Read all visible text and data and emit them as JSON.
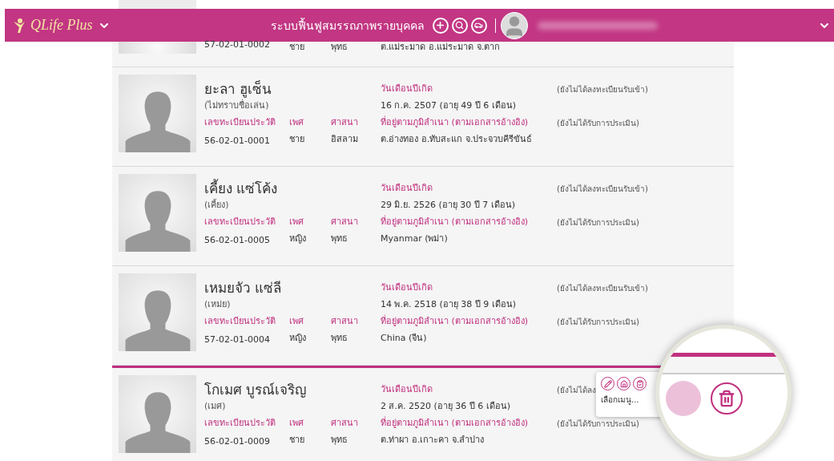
{
  "header": {
    "logo": "QLife Plus",
    "title": "ระบบฟื้นฟูสมรรถภาพรายบุคคล"
  },
  "partial_person": {
    "record_id": "57-02-01-0002",
    "gender": "ชาย",
    "religion": "พุทธ",
    "address": "ต.แม่ระมาด อ.แม่ระมาด จ.ตาก"
  },
  "people": [
    {
      "name": "ยะลา ฮูเซ็น",
      "nickname": "(ไม่ทราบชื่อเล่น)",
      "labels": {
        "record_id": "เลขทะเบียนประวัติ",
        "gender": "เพศ",
        "religion": "ศาสนา",
        "dob": "วันเดือนปีเกิด",
        "address": "ที่อยู่ตามภูมิลำเนา (ตามเอกสารอ้างอิง)"
      },
      "record_id": "56-02-01-0001",
      "gender": "ชาย",
      "religion": "อิสลาม",
      "dob": "16 ก.ค. 2507 (อายุ 49 ปี 6 เดือน)",
      "address": "ต.อ่างทอง อ.ทับสะแก จ.ประจวบคีรีขันธ์",
      "registration_status": "(ยังไม่ได้ลงทะเบียนรับเข้า)",
      "assessment_status": "(ยังไม่ได้รับการประเมิน)",
      "selected": false
    },
    {
      "name": "เคี้ยง แซ่โค้ง",
      "nickname": "(เคี้ยง)",
      "labels": {
        "record_id": "เลขทะเบียนประวัติ",
        "gender": "เพศ",
        "religion": "ศาสนา",
        "dob": "วันเดือนปีเกิด",
        "address": "ที่อยู่ตามภูมิลำเนา (ตามเอกสารอ้างอิง)"
      },
      "record_id": "56-02-01-0005",
      "gender": "หญิง",
      "religion": "พุทธ",
      "dob": "29 มิ.ย. 2526 (อายุ 30 ปี 7 เดือน)",
      "address": "Myanmar (พม่า)",
      "registration_status": "(ยังไม่ได้ลงทะเบียนรับเข้า)",
      "assessment_status": "(ยังไม่ได้รับการประเมิน)",
      "selected": false
    },
    {
      "name": "เหมยจัว แซ่ลี",
      "nickname": "(เหม่ย)",
      "labels": {
        "record_id": "เลขทะเบียนประวัติ",
        "gender": "เพศ",
        "religion": "ศาสนา",
        "dob": "วันเดือนปีเกิด",
        "address": "ที่อยู่ตามภูมิลำเนา (ตามเอกสารอ้างอิง)"
      },
      "record_id": "57-02-01-0004",
      "gender": "หญิง",
      "religion": "พุทธ",
      "dob": "14 พ.ค. 2518 (อายุ 38 ปี 9 เดือน)",
      "address": "China (จีน)",
      "registration_status": "(ยังไม่ได้ลงทะเบียนรับเข้า)",
      "assessment_status": "(ยังไม่ได้รับการประเมิน)",
      "selected": false
    },
    {
      "name": "โกเมศ บูรณ์เจริญ",
      "nickname": "(เมศ)",
      "labels": {
        "record_id": "เลขทะเบียนประวัติ",
        "gender": "เพศ",
        "religion": "ศาสนา",
        "dob": "วันเดือนปีเกิด",
        "address": "ที่อยู่ตามภูมิลำเนา (ตามเอกสารอ้างอิง)"
      },
      "record_id": "56-02-01-0009",
      "gender": "ชาย",
      "religion": "พุทธ",
      "dob": "2 ส.ค. 2520 (อายุ 36 ปี 6 เดือน)",
      "address": "ต.ท่าผา อ.เกาะคา จ.ลำปาง",
      "registration_status": "(ยังไม่ได้ลง",
      "assessment_status": "(ยังไม่ได้รับการประเมิน)",
      "selected": true
    }
  ],
  "popup_menu": {
    "hint": "เลือกเมนู..."
  }
}
